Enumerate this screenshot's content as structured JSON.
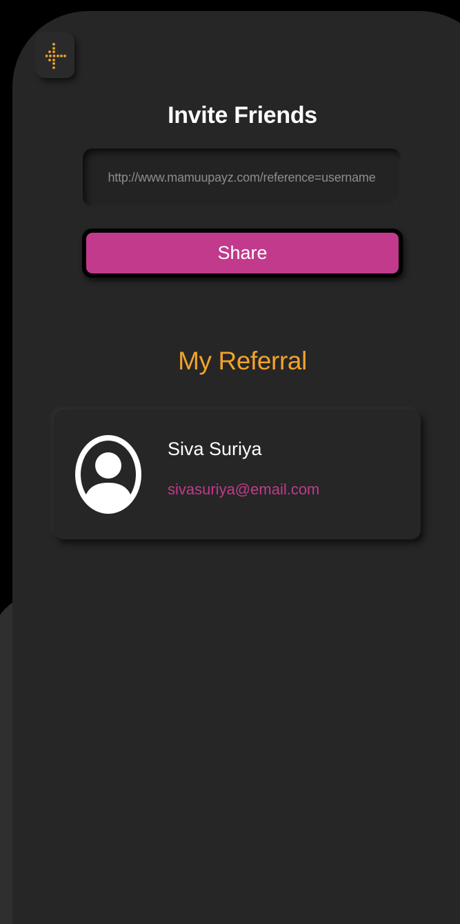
{
  "colors": {
    "background": "#000000",
    "panel": "#262626",
    "accent_orange": "#f1a32c",
    "accent_pink": "#c13a8c",
    "text_primary": "#ffffff",
    "text_muted": "#8d8d8d"
  },
  "header": {
    "back_icon": "back-arrow-dots-icon",
    "title": "Invite Friends"
  },
  "invite": {
    "link_value": "http://www.mamuupayz.com/reference=username",
    "share_label": "Share"
  },
  "referrals": {
    "section_title": "My Referral",
    "items": [
      {
        "avatar_icon": "user-avatar-icon",
        "name": "Siva Suriya",
        "email": "sivasuriya@email.com"
      }
    ]
  }
}
